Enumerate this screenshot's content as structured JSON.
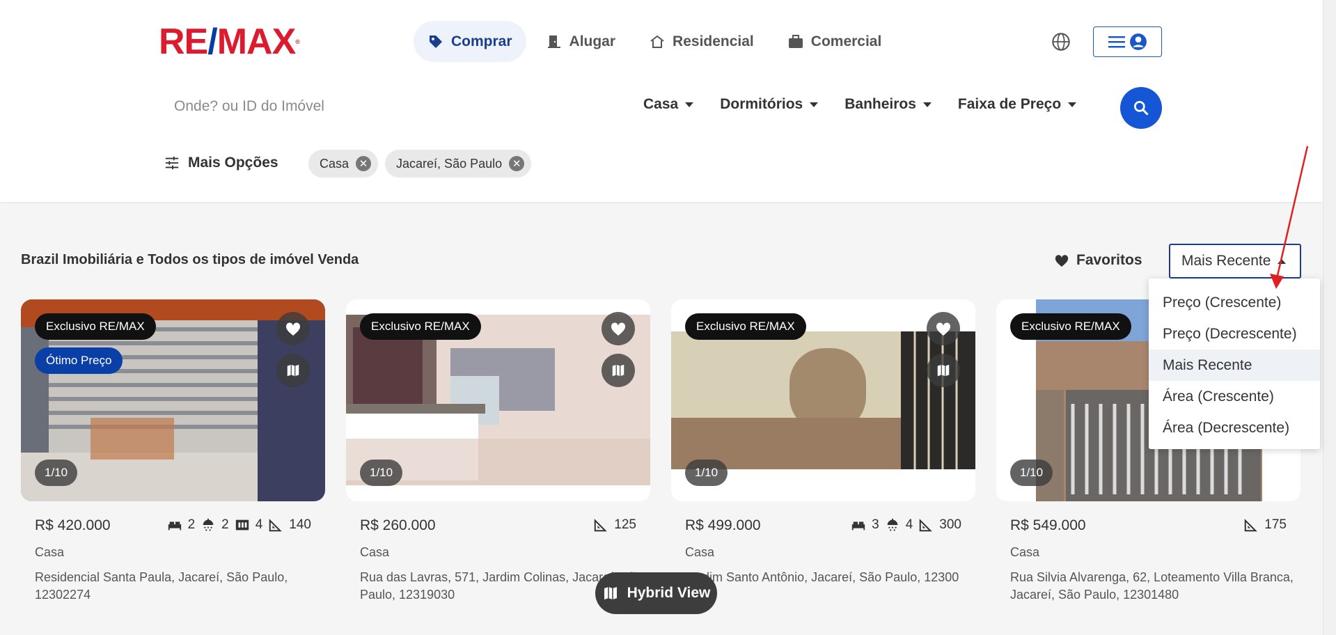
{
  "header": {
    "logo": {
      "left": "RE",
      "slash": "/",
      "right": "MAX",
      "mark": "®"
    },
    "nav": [
      {
        "label": "Comprar",
        "icon": "tag-icon",
        "active": true
      },
      {
        "label": "Alugar",
        "icon": "door-icon",
        "active": false
      },
      {
        "label": "Residencial",
        "icon": "house-icon",
        "active": false
      },
      {
        "label": "Comercial",
        "icon": "briefcase-icon",
        "active": false
      }
    ]
  },
  "search": {
    "placeholder": "Onde? ou ID do Imóvel",
    "filters": [
      "Casa",
      "Dormitórios",
      "Banheiros",
      "Faixa de Preço"
    ],
    "more_options": "Mais Opções",
    "chips": [
      "Casa",
      "Jacareí, São Paulo"
    ]
  },
  "results": {
    "title": "Brazil Imobiliária e Todos os tipos de imóvel Venda",
    "favorites_label": "Favoritos",
    "sort": {
      "selected": "Mais Recente",
      "options": [
        "Preço (Crescente)",
        "Preço (Decrescente)",
        "Mais Recente",
        "Área (Crescente)",
        "Área (Decrescente)"
      ]
    }
  },
  "listings": [
    {
      "tag": "Exclusivo RE/MAX",
      "badge": "Ótimo Preço",
      "counter": "1/10",
      "price": "R$ 420.000",
      "bedrooms": "2",
      "bathrooms": "2",
      "parking": "4",
      "area": "140",
      "type": "Casa",
      "address": "Residencial Santa Paula, Jacareí, São Paulo, 12302274"
    },
    {
      "tag": "Exclusivo RE/MAX",
      "counter": "1/10",
      "price": "R$ 260.000",
      "area": "125",
      "type": "Casa",
      "address": "Rua das Lavras, 571, Jardim Colinas, Jacareí, São Paulo, 12319030"
    },
    {
      "tag": "Exclusivo RE/MAX",
      "counter": "1/10",
      "price": "R$ 499.000",
      "bedrooms": "3",
      "bathrooms": "4",
      "area": "300",
      "type": "Casa",
      "address": "Jardim Santo Antônio, Jacareí, São Paulo, 12300"
    },
    {
      "tag": "Exclusivo RE/MAX",
      "counter": "1/10",
      "price": "R$ 549.000",
      "area": "175",
      "type": "Casa",
      "address": "Rua Silvia Alvarenga, 62, Loteamento Villa Branca, Jacareí, São Paulo, 12301480"
    }
  ],
  "hybrid_view": "Hybrid View",
  "colors": {
    "brand_red": "#dc1c2e",
    "brand_blue": "#003da5",
    "accent": "#1456d6"
  }
}
